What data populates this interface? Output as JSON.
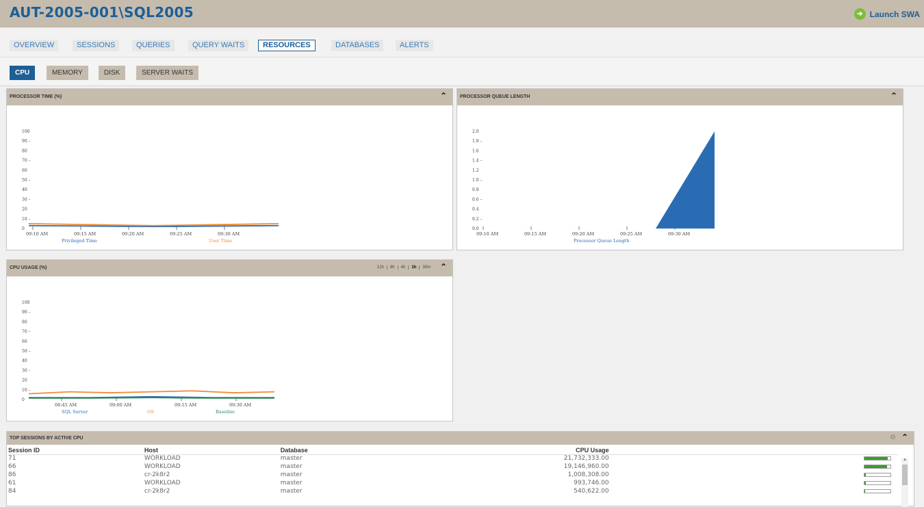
{
  "header": {
    "title": "AUT-2005-001\\SQL2005",
    "launch_label": "Launch SWA"
  },
  "tabs": [
    {
      "label": "OVERVIEW"
    },
    {
      "label": "SESSIONS"
    },
    {
      "label": "QUERIES"
    },
    {
      "label": "QUERY WAITS"
    },
    {
      "label": "RESOURCES",
      "active": true
    },
    {
      "label": "DATABASES"
    },
    {
      "label": "ALERTS"
    }
  ],
  "subtabs": [
    {
      "label": "CPU",
      "active": true
    },
    {
      "label": "MEMORY"
    },
    {
      "label": "DISK"
    },
    {
      "label": "SERVER WAITS"
    }
  ],
  "processor_time": {
    "title": "PROCESSOR TIME (%)",
    "legend": [
      "Privileged Time",
      "User Time"
    ]
  },
  "queue_length": {
    "title": "PROCESSOR QUEUE LENGTH",
    "legend": [
      "Processor Queue Length"
    ]
  },
  "cpu_usage": {
    "title": "CPU USAGE (%)",
    "ranges": [
      "12h",
      "8h",
      "4h",
      "1h",
      "30m"
    ],
    "selected_range": "1h",
    "legend": [
      "SQL Server",
      "OS",
      "Baseline"
    ]
  },
  "top_sessions": {
    "title": "TOP SESSIONS BY ACTIVE CPU",
    "columns": [
      "Session ID",
      "Host",
      "Database",
      "CPU Usage"
    ],
    "rows": [
      {
        "session": "71",
        "host": "WORKLOAD",
        "database": "master",
        "cpu": "21,732,333.00",
        "pct": 0.9
      },
      {
        "session": "66",
        "host": "WORKLOAD",
        "database": "master",
        "cpu": "19,146,960.00",
        "pct": 0.88
      },
      {
        "session": "86",
        "host": "cr-2k8r2",
        "database": "master",
        "cpu": "1,008,308.00",
        "pct": 0.05
      },
      {
        "session": "61",
        "host": "WORKLOAD",
        "database": "master",
        "cpu": "993,746.00",
        "pct": 0.05
      },
      {
        "session": "84",
        "host": "cr-2k8r2",
        "database": "master",
        "cpu": "540,622.00",
        "pct": 0.03
      }
    ]
  },
  "chart_data": [
    {
      "type": "line",
      "title": "PROCESSOR TIME (%)",
      "x": [
        "09:10 AM",
        "09:15 AM",
        "09:20 AM",
        "09:25 AM",
        "09:30 AM"
      ],
      "yticks": [
        "100",
        "90",
        "80",
        "70",
        "60",
        "50",
        "40",
        "30",
        "20",
        "10",
        "0"
      ],
      "ylim": [
        0,
        100
      ],
      "series": [
        {
          "name": "Privileged Time",
          "color": "#2a6cb3",
          "values": [
            3,
            2.5,
            2,
            2.5,
            3
          ]
        },
        {
          "name": "User Time",
          "color": "#f28b30",
          "values": [
            5,
            4,
            3,
            4,
            5
          ]
        }
      ]
    },
    {
      "type": "area",
      "title": "PROCESSOR QUEUE LENGTH",
      "x": [
        "09:10 AM",
        "09:15 AM",
        "09:20 AM",
        "09:25 AM",
        "09:30 AM"
      ],
      "yticks": [
        "2.0",
        "1.8",
        "1.6",
        "1.4",
        "1.2",
        "1.0",
        "0.8",
        "0.6",
        "0.4",
        "0.2",
        "0.0"
      ],
      "ylim": [
        0,
        2.0
      ],
      "series": [
        {
          "name": "Processor Queue Length",
          "color": "#2a6cb3",
          "values": [
            0,
            0,
            0,
            0,
            0.0,
            2.0
          ]
        }
      ]
    },
    {
      "type": "line",
      "title": "CPU USAGE (%)",
      "x": [
        "08:45 AM",
        "09:00 AM",
        "09:15 AM",
        "09:30 AM"
      ],
      "yticks": [
        "100",
        "90",
        "80",
        "70",
        "60",
        "50",
        "40",
        "30",
        "20",
        "10",
        "0"
      ],
      "ylim": [
        0,
        100
      ],
      "series": [
        {
          "name": "SQL Server",
          "color": "#2a6cb3",
          "values": [
            2,
            2,
            3,
            2,
            2
          ]
        },
        {
          "name": "OS",
          "color": "#f28b30",
          "values": [
            6,
            8,
            7,
            8,
            9,
            7,
            8
          ]
        },
        {
          "name": "Baseline",
          "color": "#2e8b57",
          "values": [
            1.5,
            1.5,
            2,
            1.5,
            1.5
          ]
        }
      ]
    }
  ]
}
